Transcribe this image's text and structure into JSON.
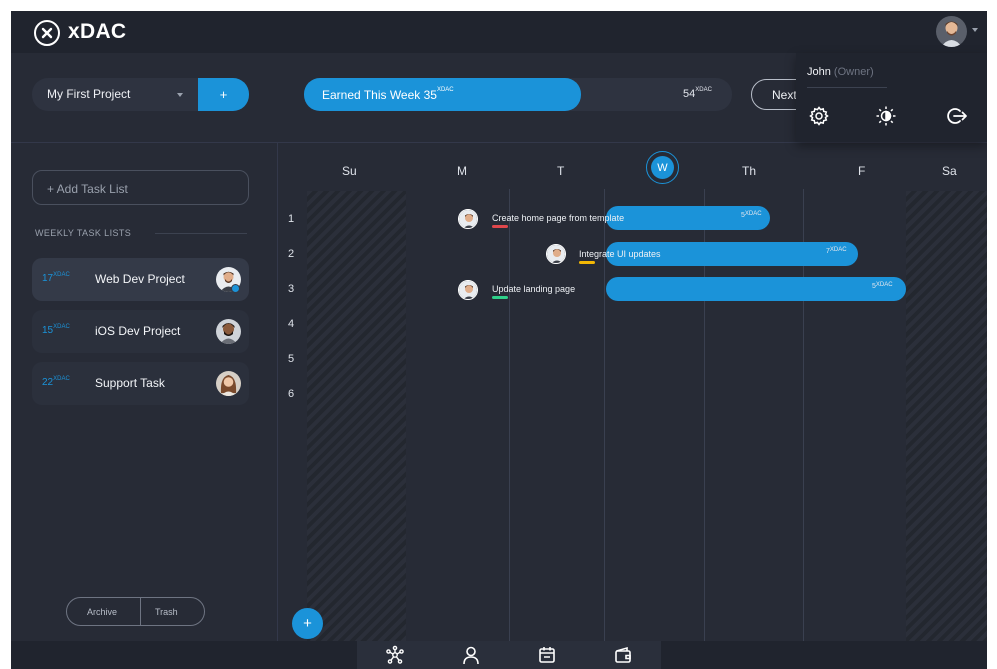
{
  "app": {
    "name": "xDAC"
  },
  "header": {
    "project_selected": "My First Project",
    "add_project_label": "+",
    "earned": {
      "label": "Earned This Week 35",
      "unit": "XDAC",
      "max_value": "54",
      "max_unit": "XDAC",
      "progress": 0.648
    },
    "next_label": "Next"
  },
  "user_menu": {
    "name": "John",
    "role": "(Owner)",
    "icons": [
      "settings-icon",
      "brightness-icon",
      "logout-icon"
    ]
  },
  "sidebar": {
    "add_task_list_placeholder": "+ Add Task List",
    "section_label": "WEEKLY TASK LISTS",
    "task_lists": [
      {
        "points": "17",
        "unit": "XDAC",
        "name": "Web Dev Project",
        "active": true
      },
      {
        "points": "15",
        "unit": "XDAC",
        "name": "iOS Dev Project",
        "active": false
      },
      {
        "points": "22",
        "unit": "XDAC",
        "name": "Support Task",
        "active": false
      }
    ],
    "archive_label": "Archive",
    "trash_label": "Trash"
  },
  "calendar": {
    "days": [
      "Su",
      "M",
      "T",
      "W",
      "Th",
      "F",
      "Sa"
    ],
    "today": "W",
    "rows": [
      "1",
      "2",
      "3",
      "4",
      "5",
      "6"
    ],
    "events": [
      {
        "title": "Create home page from template",
        "points": "5",
        "unit": "XDAC",
        "start_day": "M",
        "end_day": "W",
        "row": 1,
        "marker_color": "#e0474c"
      },
      {
        "title": "Integrate UI updates",
        "points": "7",
        "unit": "XDAC",
        "start_day": "T",
        "end_day": "Th",
        "row": 2,
        "marker_color": "#f2b705"
      },
      {
        "title": "Update landing page",
        "points": "5",
        "unit": "XDAC",
        "start_day": "M",
        "end_day": "F",
        "row": 3,
        "marker_color": "#2fd18a"
      }
    ],
    "add_label": "+"
  },
  "bottom_nav": {
    "icons": [
      "network-icon",
      "user-icon",
      "calendar-icon",
      "wallet-icon"
    ]
  },
  "colors": {
    "accent": "#1b93d9",
    "background": "#272b36",
    "panel": "#20242e"
  }
}
